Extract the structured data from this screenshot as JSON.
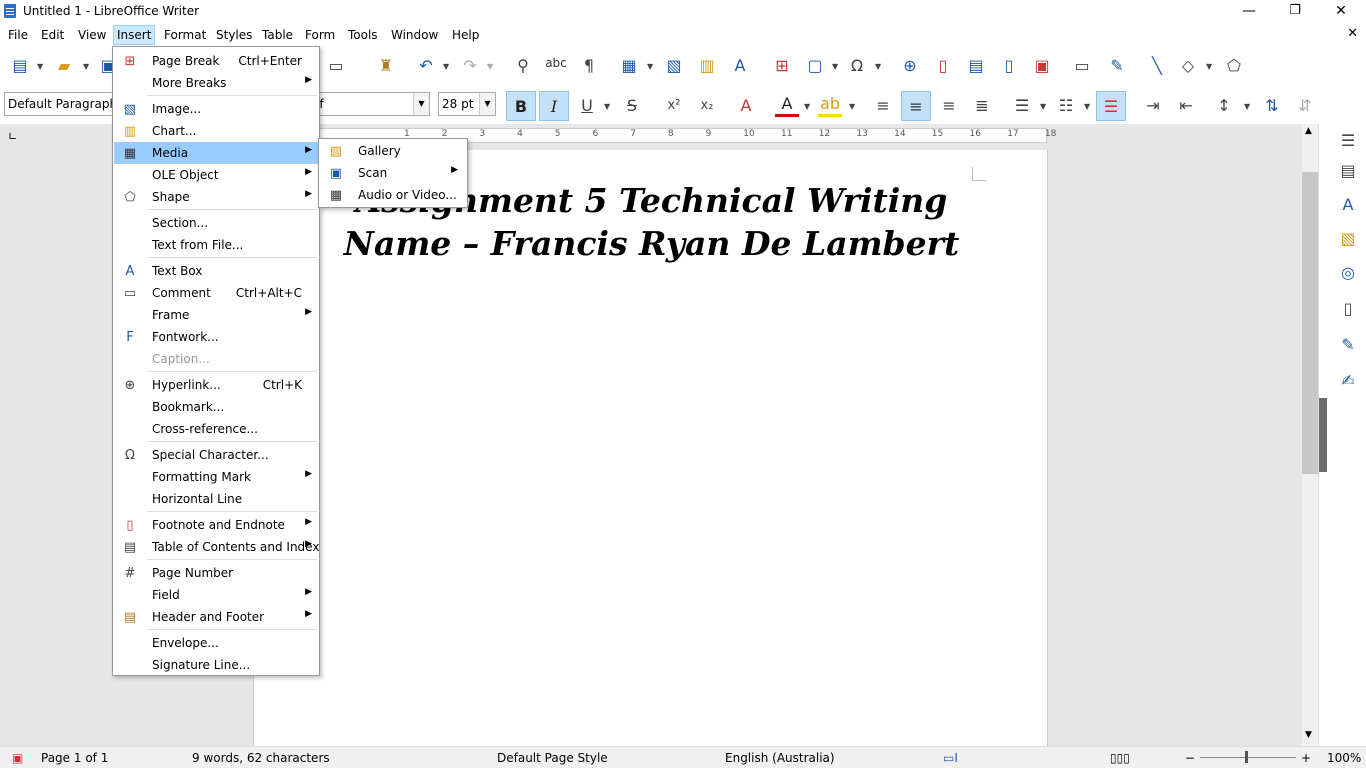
{
  "window": {
    "title": "Untitled 1 - LibreOffice Writer",
    "minimize": "—",
    "restore": "❐",
    "close": "✕"
  },
  "menubar": {
    "items": [
      "File",
      "Edit",
      "View",
      "Insert",
      "Format",
      "Styles",
      "Table",
      "Form",
      "Tools",
      "Window",
      "Help"
    ],
    "active": "Insert",
    "doc_close": "✕"
  },
  "formatting": {
    "paragraph_style": "Default Paragraph S",
    "font_name": "if",
    "font_size": "28 pt"
  },
  "document": {
    "lines": [
      "Assignment 5 Technical Writing",
      "Name –  Francis Ryan De Lambert"
    ]
  },
  "ruler": {
    "ticks": [
      "1",
      "2",
      "3",
      "4",
      "5",
      "6",
      "7",
      "8",
      "9",
      "10",
      "11",
      "12",
      "13",
      "14",
      "15",
      "16",
      "17",
      "18"
    ]
  },
  "insert_menu": {
    "items": [
      {
        "label": "Page Break",
        "shortcut": "Ctrl+Enter",
        "icon": "page-break-icon"
      },
      {
        "label": "More Breaks",
        "submenu": true
      },
      {
        "label": "Image...",
        "icon": "image-icon"
      },
      {
        "label": "Chart...",
        "icon": "chart-icon"
      },
      {
        "label": "Media",
        "submenu": true,
        "icon": "media-icon",
        "highlighted": true
      },
      {
        "label": "OLE Object",
        "submenu": true
      },
      {
        "label": "Shape",
        "submenu": true,
        "icon": "shape-icon"
      },
      {
        "label": "Section..."
      },
      {
        "label": "Text from File..."
      },
      {
        "label": "Text Box",
        "icon": "text-box-icon"
      },
      {
        "label": "Comment",
        "shortcut": "Ctrl+Alt+C",
        "icon": "comment-icon"
      },
      {
        "label": "Frame",
        "submenu": true
      },
      {
        "label": "Fontwork...",
        "icon": "fontwork-icon"
      },
      {
        "label": "Caption...",
        "disabled": true
      },
      {
        "label": "Hyperlink...",
        "shortcut": "Ctrl+K",
        "icon": "hyperlink-icon"
      },
      {
        "label": "Bookmark..."
      },
      {
        "label": "Cross-reference..."
      },
      {
        "label": "Special Character...",
        "icon": "omega-icon"
      },
      {
        "label": "Formatting Mark",
        "submenu": true
      },
      {
        "label": "Horizontal Line"
      },
      {
        "label": "Footnote and Endnote",
        "submenu": true,
        "icon": "footnote-icon"
      },
      {
        "label": "Table of Contents and Index",
        "submenu": true,
        "icon": "toc-icon"
      },
      {
        "label": "Page Number",
        "icon": "page-number-icon"
      },
      {
        "label": "Field",
        "submenu": true
      },
      {
        "label": "Header and Footer",
        "submenu": true,
        "icon": "header-footer-icon"
      },
      {
        "label": "Envelope..."
      },
      {
        "label": "Signature Line..."
      }
    ]
  },
  "media_submenu": {
    "items": [
      {
        "label": "Gallery",
        "icon": "gallery-icon"
      },
      {
        "label": "Scan",
        "submenu": true,
        "icon": "scan-icon"
      },
      {
        "label": "Audio or Video...",
        "icon": "video-icon"
      }
    ]
  },
  "statusbar": {
    "page": "Page 1 of 1",
    "words": "9 words, 62 characters",
    "page_style": "Default Page Style",
    "language": "English (Australia)",
    "zoom": "100%"
  },
  "colors": {
    "accent": "#1c5aa6",
    "menu_highlight": "#99ccff",
    "menubar_active": "#cce8ff"
  }
}
